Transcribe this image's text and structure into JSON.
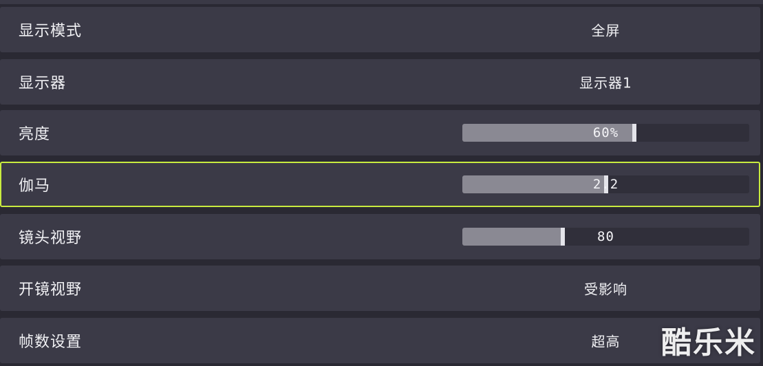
{
  "settings": {
    "rows": [
      {
        "label": "显示模式",
        "value": "全屏"
      },
      {
        "label": "显示器",
        "value": "显示器1"
      },
      {
        "label": "亮度",
        "value_text": "60%",
        "level": 0.6
      },
      {
        "label": "伽马",
        "value_text": "2.2",
        "level": 0.5,
        "selected": true
      },
      {
        "label": "镜头视野",
        "value_text": "80",
        "level": 0.35
      },
      {
        "label": "开镜视野",
        "value": "受影响"
      },
      {
        "label": "帧数设置",
        "value": "超高"
      }
    ]
  },
  "watermark": "酷乐米",
  "colors": {
    "selection_border": "#c9ec3f",
    "row_background": "#3b3a47",
    "slider_fill": "#8a8993"
  }
}
